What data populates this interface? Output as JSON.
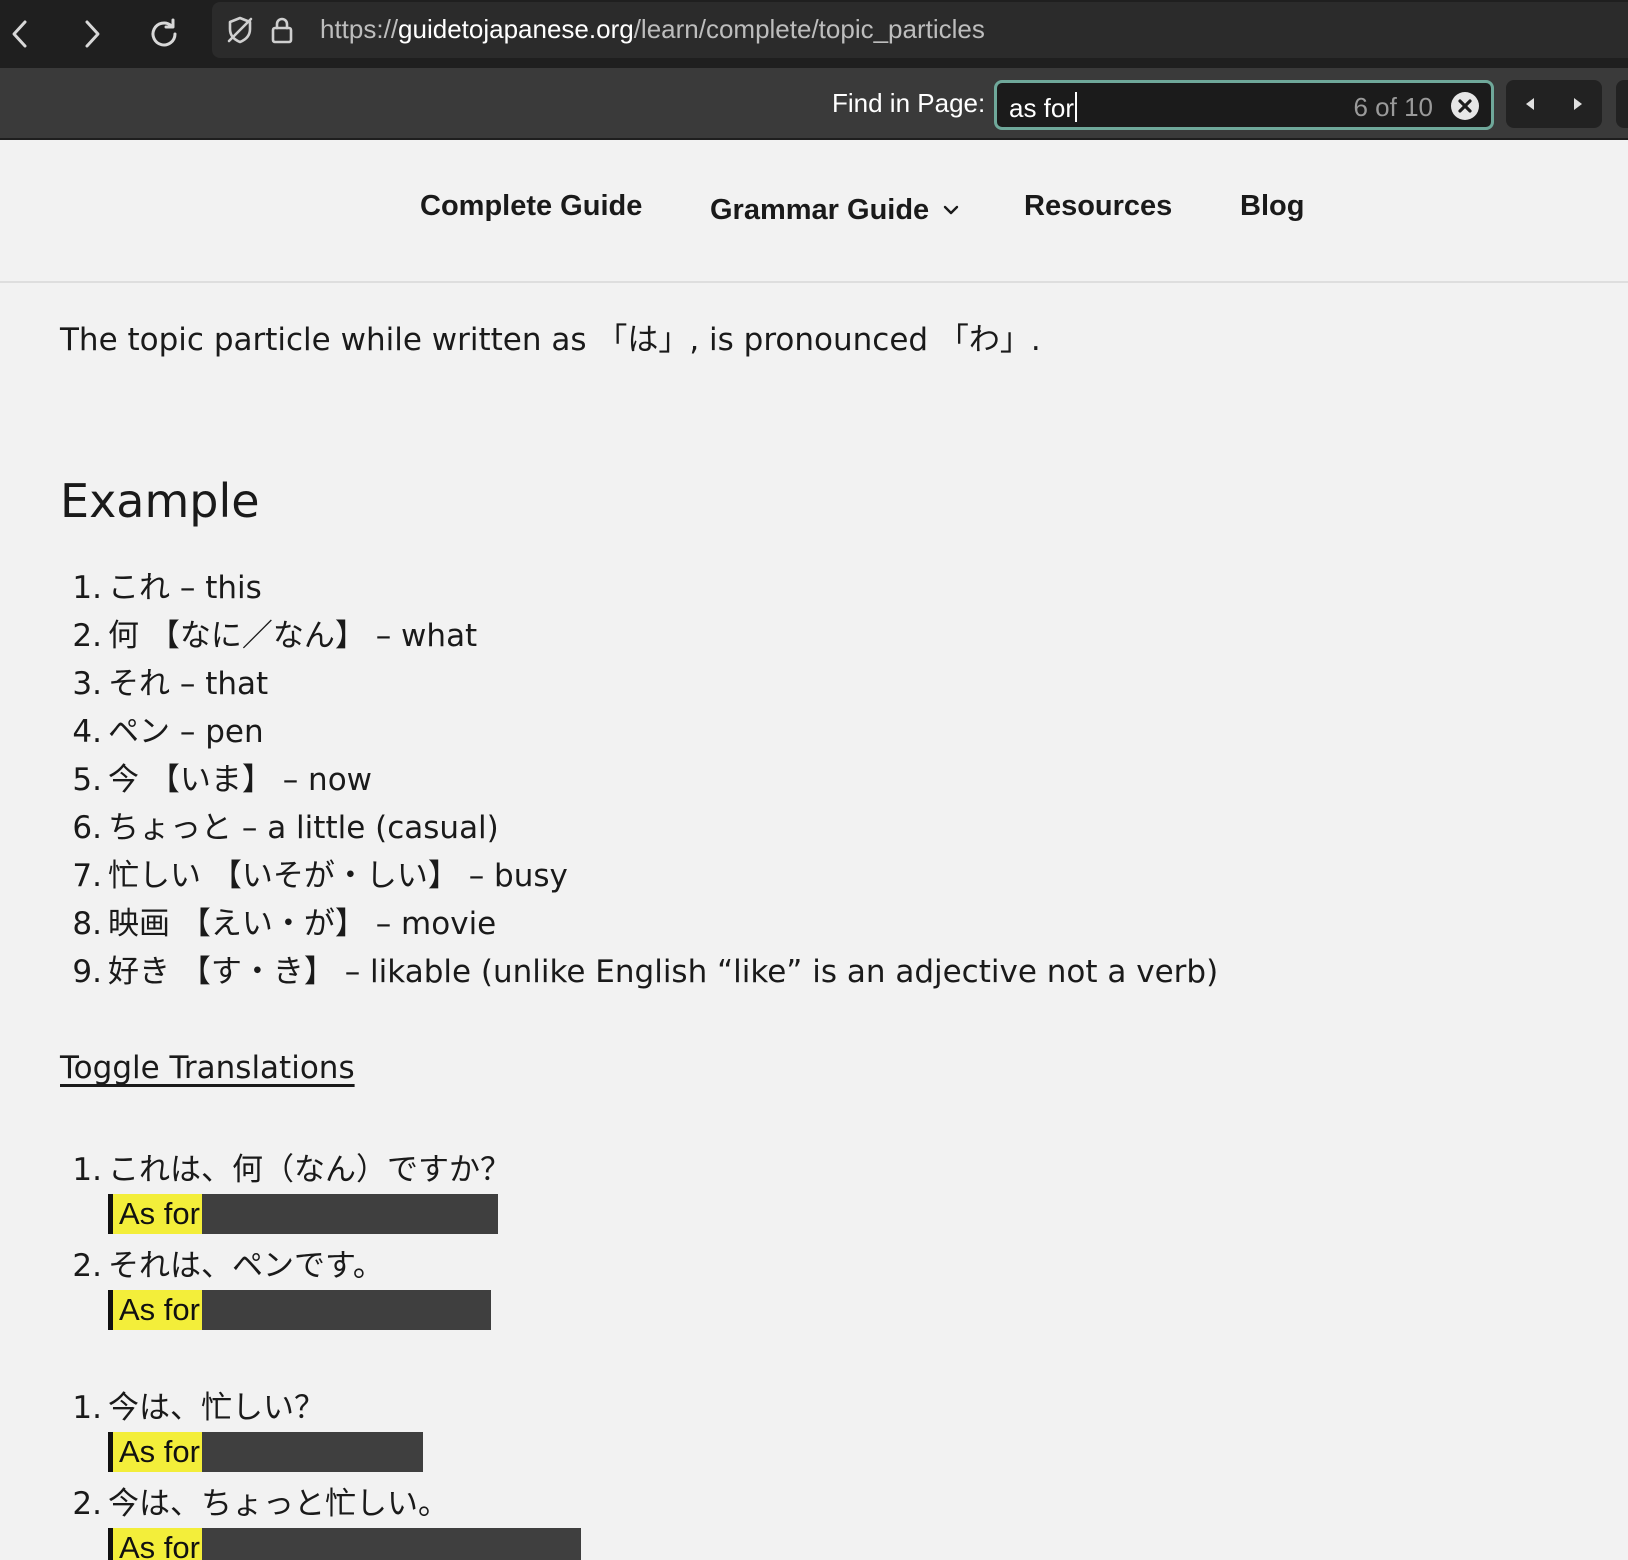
{
  "browser": {
    "url_scheme": "https://",
    "url_domain": "guidetojapanese.org",
    "url_path": "/learn/complete/topic_particles"
  },
  "find": {
    "label": "Find in Page:",
    "query": "as for",
    "count": "6 of 10"
  },
  "nav": {
    "items": [
      {
        "label": "Complete Guide"
      },
      {
        "label": "Grammar Guide"
      },
      {
        "label": "Resources"
      },
      {
        "label": "Blog"
      }
    ]
  },
  "content": {
    "intro": "The topic particle while written as 「は」, is pronounced 「わ」.",
    "heading": "Example",
    "vocab": [
      {
        "num": "1.",
        "text": "これ – this"
      },
      {
        "num": "2.",
        "text": "何 【なに／なん】 – what"
      },
      {
        "num": "3.",
        "text": "それ – that"
      },
      {
        "num": "4.",
        "text": "ペン – pen"
      },
      {
        "num": "5.",
        "text": "今 【いま】 – now"
      },
      {
        "num": "6.",
        "text": "ちょっと – a little (casual)"
      },
      {
        "num": "7.",
        "text": "忙しい 【いそが・しい】 – busy"
      },
      {
        "num": "8.",
        "text": "映画 【えい・が】 – movie"
      },
      {
        "num": "9.",
        "text": "好き 【す・き】 – likable (unlike English “like” is an adjective not a verb)"
      }
    ],
    "toggle": "Toggle Translations",
    "examples_a": [
      {
        "num": "1.",
        "jp": "これは、何（なん）ですか？",
        "highlight": "As for"
      },
      {
        "num": "2.",
        "jp": "それは、ペンです。",
        "highlight": "As for"
      }
    ],
    "examples_b": [
      {
        "num": "1.",
        "jp": "今は、忙しい？",
        "highlight": "As for"
      },
      {
        "num": "2.",
        "jp": "今は、ちょっと忙しい。",
        "highlight": "As for"
      }
    ]
  }
}
